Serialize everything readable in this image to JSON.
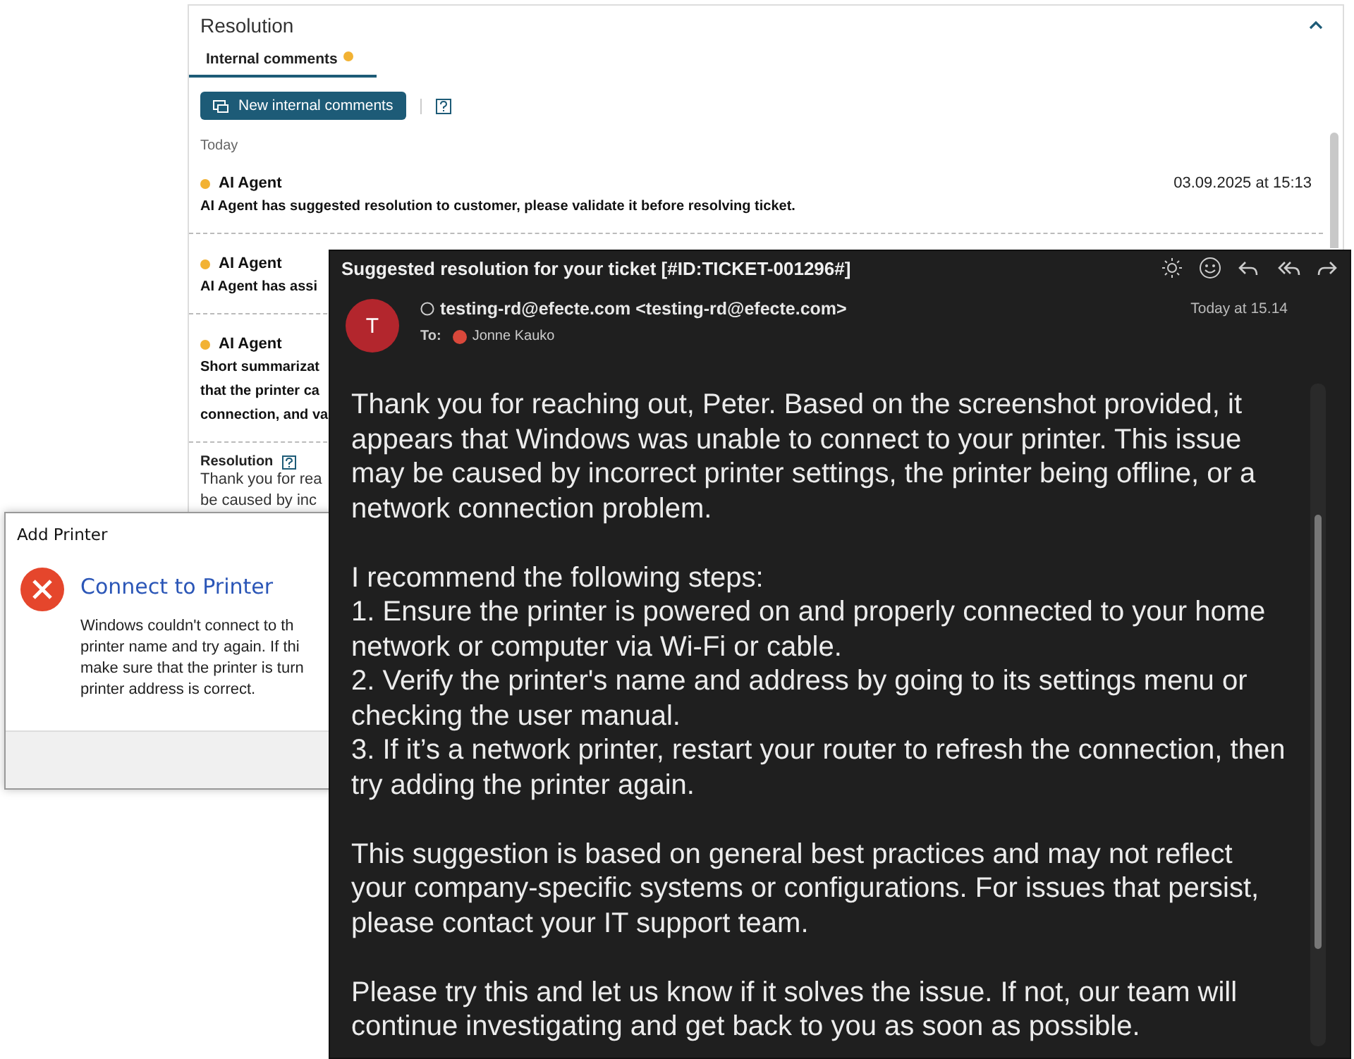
{
  "resolution_panel": {
    "title": "Resolution",
    "tabs": [
      {
        "label": "Internal comments",
        "selected": true
      }
    ],
    "new_button": "New internal comments",
    "section": "Today",
    "comments": [
      {
        "author": "AI Agent",
        "time": "03.09.2025 at 15:13",
        "lines": [
          "AI Agent has suggested resolution to customer, please validate it before resolving ticket."
        ]
      },
      {
        "author": "AI Agent",
        "lines": [
          "AI Agent has assi"
        ]
      },
      {
        "author": "AI Agent",
        "lines": [
          "Short summarizat",
          "that the printer ca",
          "connection, and va"
        ]
      }
    ],
    "resolution": {
      "label": "Resolution",
      "lines": [
        "Thank you for rea",
        "be caused by inc"
      ]
    }
  },
  "dialog": {
    "title": "Add Printer",
    "heading": "Connect to Printer",
    "lines": [
      "Windows couldn't connect to th",
      "printer name and try again. If thi",
      "make sure that the printer is turn",
      "printer address is correct."
    ]
  },
  "email": {
    "subject": "Suggested resolution for your ticket [#ID:TICKET-001296#]",
    "avatar": "T",
    "from": "testing-rd@efecte.com <testing-rd@efecte.com>",
    "to_label": "To:",
    "to": "Jonne Kauko",
    "time": "Today at 15.14",
    "paragraphs": [
      [
        "Thank you for reaching out, Peter. Based on the screenshot provided, it appears that Windows was unable to connect to your printer. This issue may be caused by incorrect printer settings, the printer being offline, or a network connection problem."
      ],
      [
        "I recommend the following steps:",
        "1. Ensure the printer is powered on and properly connected to your home network or computer via Wi-Fi or cable.",
        "2. Verify the printer's name and address by going to its settings menu or checking the user manual.",
        "3. If it’s a network printer, restart your router to refresh the connection, then try adding the printer again."
      ],
      [
        "This suggestion is based on general best practices and may not reflect your company-specific systems or configurations. For issues that persist, please contact your IT support team."
      ],
      [
        "Please try this and let us know if it solves the issue. If not, our team will continue investigating and get back to you as soon as possible."
      ]
    ]
  }
}
